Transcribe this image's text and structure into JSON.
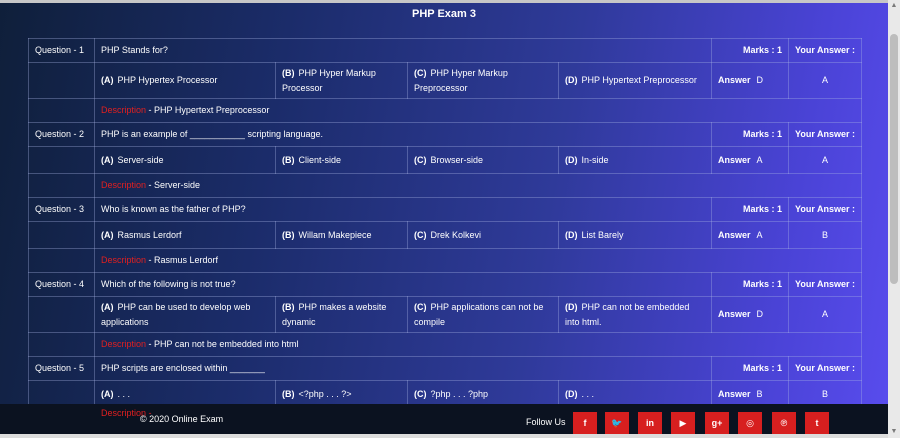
{
  "page": {
    "title": "PHP Exam 3"
  },
  "labels": {
    "marks": "Marks : 1",
    "your_answer": "Your Answer :",
    "answer": "Answer",
    "description": "Description"
  },
  "questions": [
    {
      "label": "Question - 1",
      "text": "PHP Stands for?",
      "options": [
        {
          "letter": "(A)",
          "text": "PHP Hypertex Processor"
        },
        {
          "letter": "(B)",
          "text": "PHP Hyper Markup Processor"
        },
        {
          "letter": "(C)",
          "text": "PHP Hyper Markup Preprocessor"
        },
        {
          "letter": "(D)",
          "text": "PHP Hypertext Preprocessor"
        }
      ],
      "answer": "D",
      "your_answer": "A",
      "description": "PHP Hypertext Preprocessor"
    },
    {
      "label": "Question - 2",
      "text": "PHP is an example of ___________ scripting language.",
      "options": [
        {
          "letter": "(A)",
          "text": "Server-side"
        },
        {
          "letter": "(B)",
          "text": "Client-side"
        },
        {
          "letter": "(C)",
          "text": "Browser-side"
        },
        {
          "letter": "(D)",
          "text": "In-side"
        }
      ],
      "answer": "A",
      "your_answer": "A",
      "description": "Server-side"
    },
    {
      "label": "Question - 3",
      "text": "Who is known as the father of PHP?",
      "options": [
        {
          "letter": "(A)",
          "text": "Rasmus Lerdorf"
        },
        {
          "letter": "(B)",
          "text": "Willam Makepiece"
        },
        {
          "letter": "(C)",
          "text": "Drek Kolkevi"
        },
        {
          "letter": "(D)",
          "text": "List Barely"
        }
      ],
      "answer": "A",
      "your_answer": "B",
      "description": "Rasmus Lerdorf"
    },
    {
      "label": "Question - 4",
      "text": "Which of the following is not true?",
      "options": [
        {
          "letter": "(A)",
          "text": "PHP can be used to develop web applications"
        },
        {
          "letter": "(B)",
          "text": "PHP makes a website dynamic"
        },
        {
          "letter": "(C)",
          "text": "PHP applications can not be compile"
        },
        {
          "letter": "(D)",
          "text": "PHP can not be embedded into html."
        }
      ],
      "answer": "D",
      "your_answer": "A",
      "description": "PHP can not be embedded into html"
    },
    {
      "label": "Question - 5",
      "text": "PHP scripts are enclosed within _______",
      "options": [
        {
          "letter": "(A)",
          "text": ". . ."
        },
        {
          "letter": "(B)",
          "text": "<?php . . . ?>"
        },
        {
          "letter": "(C)",
          "text": "?php . . . ?php"
        },
        {
          "letter": "(D)",
          "text": ". . ."
        }
      ],
      "answer": "B",
      "your_answer": "B"
    }
  ],
  "footer": {
    "copyright": "© 2020 Online Exam",
    "follow_us": "Follow Us",
    "social": [
      {
        "icon": "facebook-icon",
        "glyph": "f"
      },
      {
        "icon": "twitter-icon",
        "glyph": "🐦"
      },
      {
        "icon": "linkedin-icon",
        "glyph": "in"
      },
      {
        "icon": "youtube-icon",
        "glyph": "▶"
      },
      {
        "icon": "google-plus-icon",
        "glyph": "g+"
      },
      {
        "icon": "instagram-icon",
        "glyph": "◎"
      },
      {
        "icon": "pinterest-icon",
        "glyph": "℗"
      },
      {
        "icon": "tumblr-icon",
        "glyph": "t"
      }
    ],
    "description_peek": "Description -"
  },
  "colors": {
    "description_label": "#e02020",
    "social_bg": "#d71f1f"
  }
}
